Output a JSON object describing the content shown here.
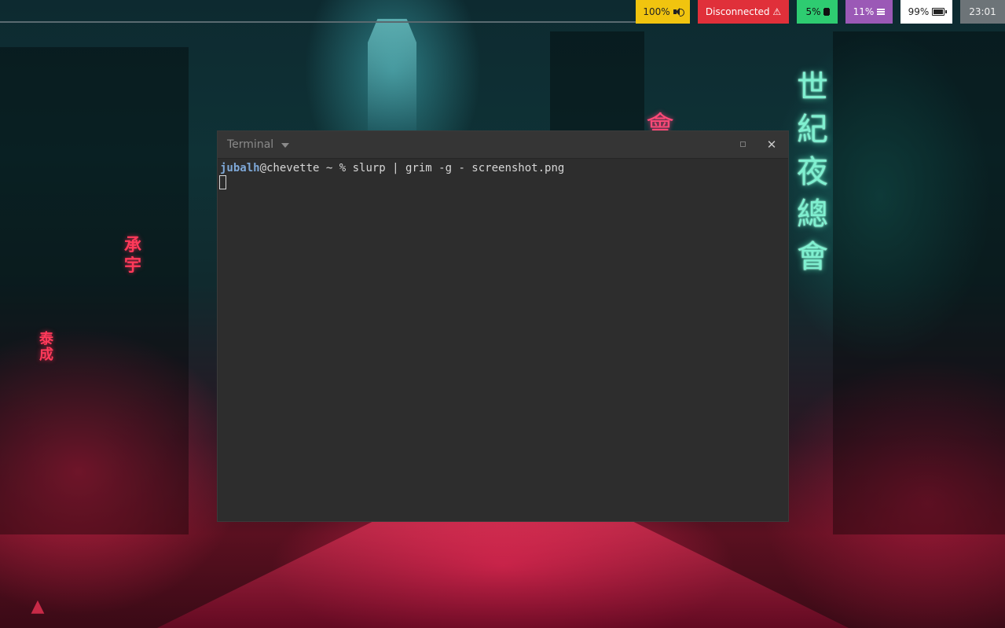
{
  "status_bar": {
    "volume": {
      "label": "100%",
      "icon": "speaker-icon",
      "color": "#f1c40f"
    },
    "network": {
      "label": "Disconnected ⚠",
      "icon": "warning-icon",
      "color": "#e0303a"
    },
    "cpu": {
      "label": "5%",
      "icon": "chip-icon",
      "color": "#2ecc71"
    },
    "memory": {
      "label": "11%",
      "icon": "menu-icon",
      "color": "#9b59b6"
    },
    "battery": {
      "label": "99%",
      "icon": "battery-icon",
      "color": "#ffffff"
    },
    "clock": {
      "label": "23:01",
      "color": "#6d7478"
    }
  },
  "terminal": {
    "title": "Terminal",
    "prompt_user": "jubalh",
    "prompt_rest": "@chevette ~ % ",
    "command": "slurp | grim -g - screenshot.png",
    "close_glyph": "✕"
  }
}
